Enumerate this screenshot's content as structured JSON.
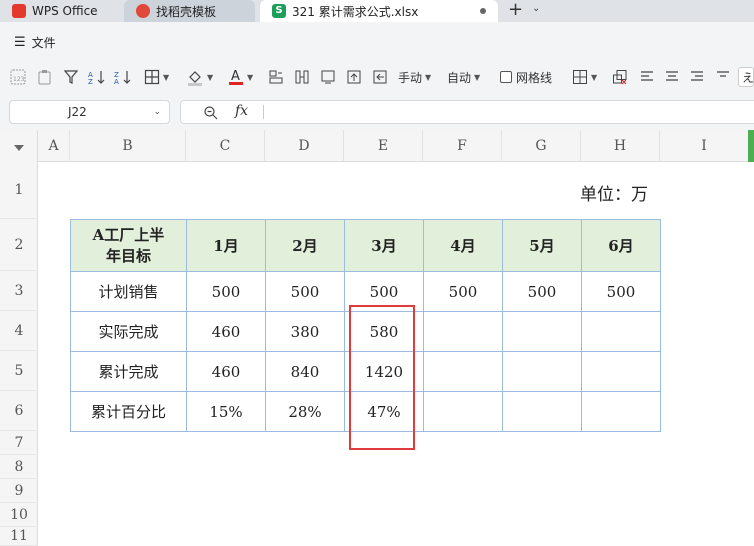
{
  "tabs": {
    "wps": "WPS Office",
    "template": "找稻壳模板",
    "file": "321 累计需求公式.xlsx",
    "file_icon_letter": "S",
    "new_tab": "+"
  },
  "menu": {
    "file_label": "文件"
  },
  "toolbar": {
    "manual": "手动",
    "auto": "自动",
    "gridlines": "网格线",
    "truncated_right": "え"
  },
  "formula_bar": {
    "cell_ref": "J22",
    "fx": "fx",
    "content": ""
  },
  "columns": [
    "A",
    "B",
    "C",
    "D",
    "E",
    "F",
    "G",
    "H",
    "I"
  ],
  "rows": [
    "1",
    "2",
    "3",
    "4",
    "5",
    "6",
    "7",
    "8",
    "9",
    "10",
    "11"
  ],
  "unit_label": "单位：万",
  "table": {
    "header": {
      "label_line1": "A工厂上半",
      "label_line2": "年目标",
      "months": [
        "1月",
        "2月",
        "3月",
        "4月",
        "5月",
        "6月"
      ]
    },
    "rows": [
      {
        "label": "计划销售",
        "values": [
          "500",
          "500",
          "500",
          "500",
          "500",
          "500"
        ]
      },
      {
        "label": "实际完成",
        "values": [
          "460",
          "380",
          "580",
          "",
          "",
          ""
        ]
      },
      {
        "label": "累计完成",
        "values": [
          "460",
          "840",
          "1420",
          "",
          "",
          ""
        ]
      },
      {
        "label": "累计百分比",
        "values": [
          "15%",
          "28%",
          "47%",
          "",
          "",
          ""
        ]
      }
    ]
  },
  "colors": {
    "header_fill": "#e2efda",
    "table_border": "#9bbbe0",
    "highlight": "#e23b3b",
    "accent_green": "#4caf50"
  }
}
